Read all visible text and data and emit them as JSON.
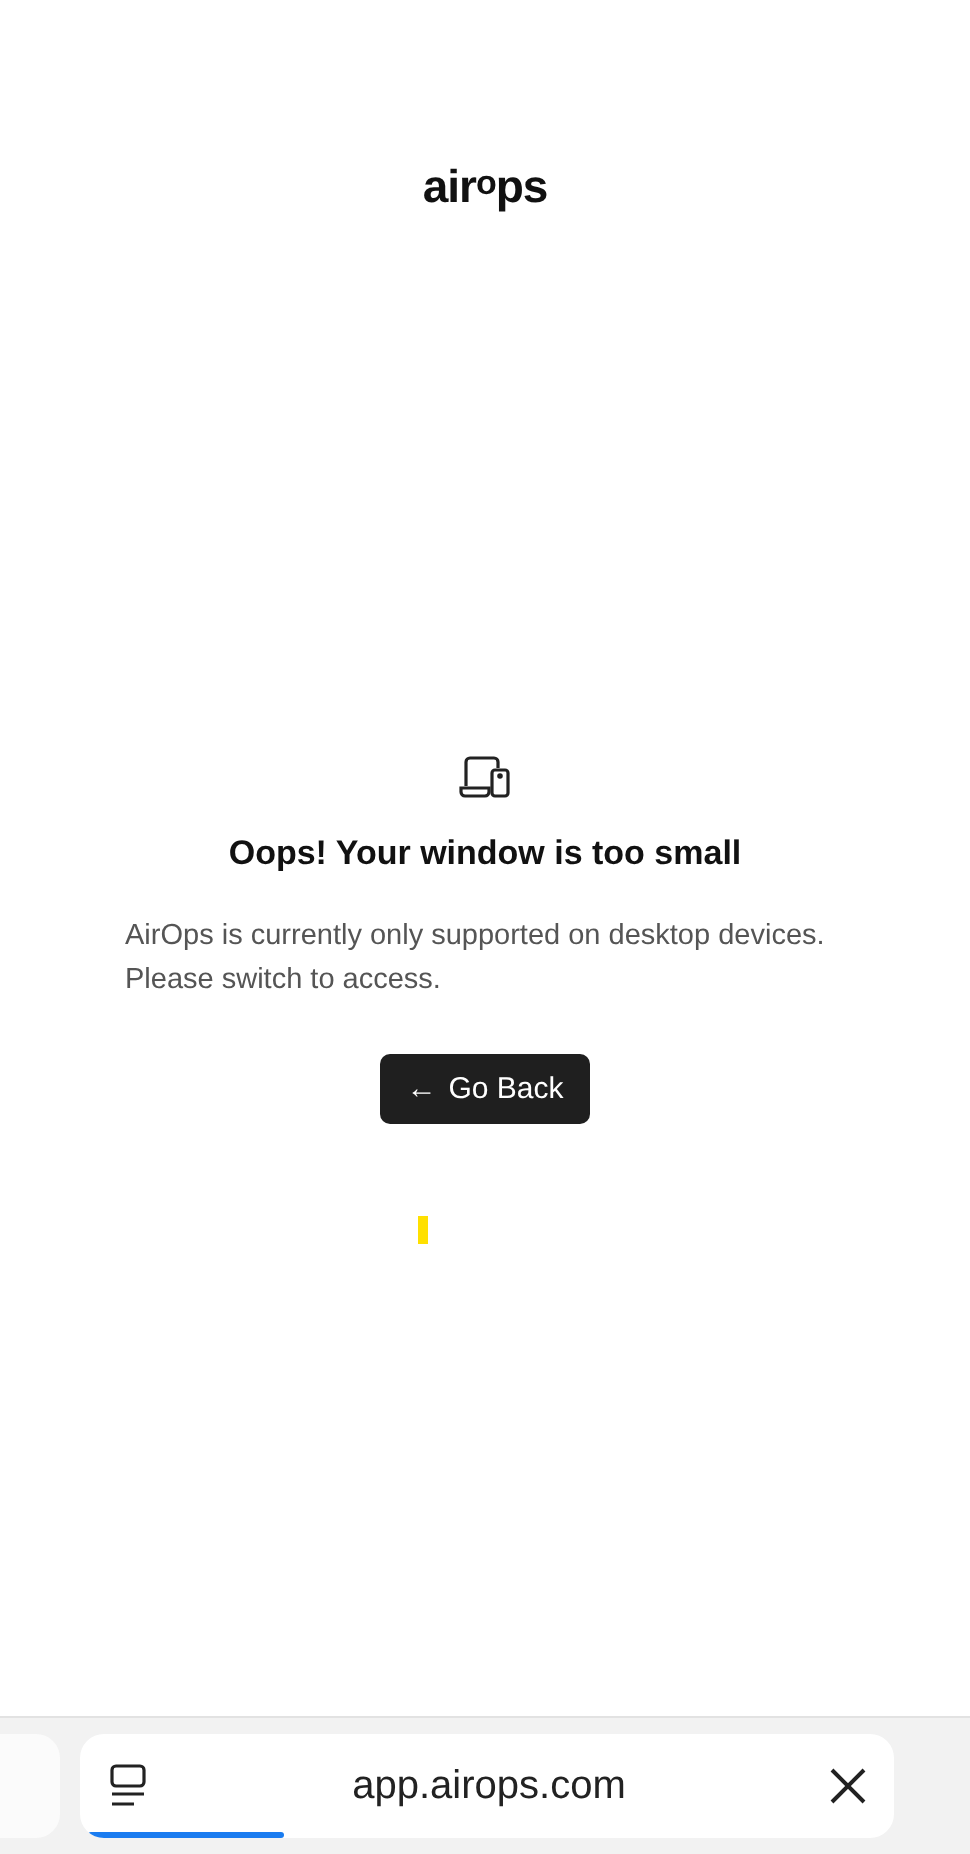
{
  "logo": "air$^{o}$ps",
  "message": {
    "title": "Oops! Your window is too small",
    "body": "AirOps is currently only supported on desktop devices. Please switch to access.",
    "button": {
      "arrow": "←",
      "label": "Go Back"
    }
  },
  "browser_bar": {
    "url": "app.airops.com",
    "loading": {
      "level": 0.24
    }
  }
}
